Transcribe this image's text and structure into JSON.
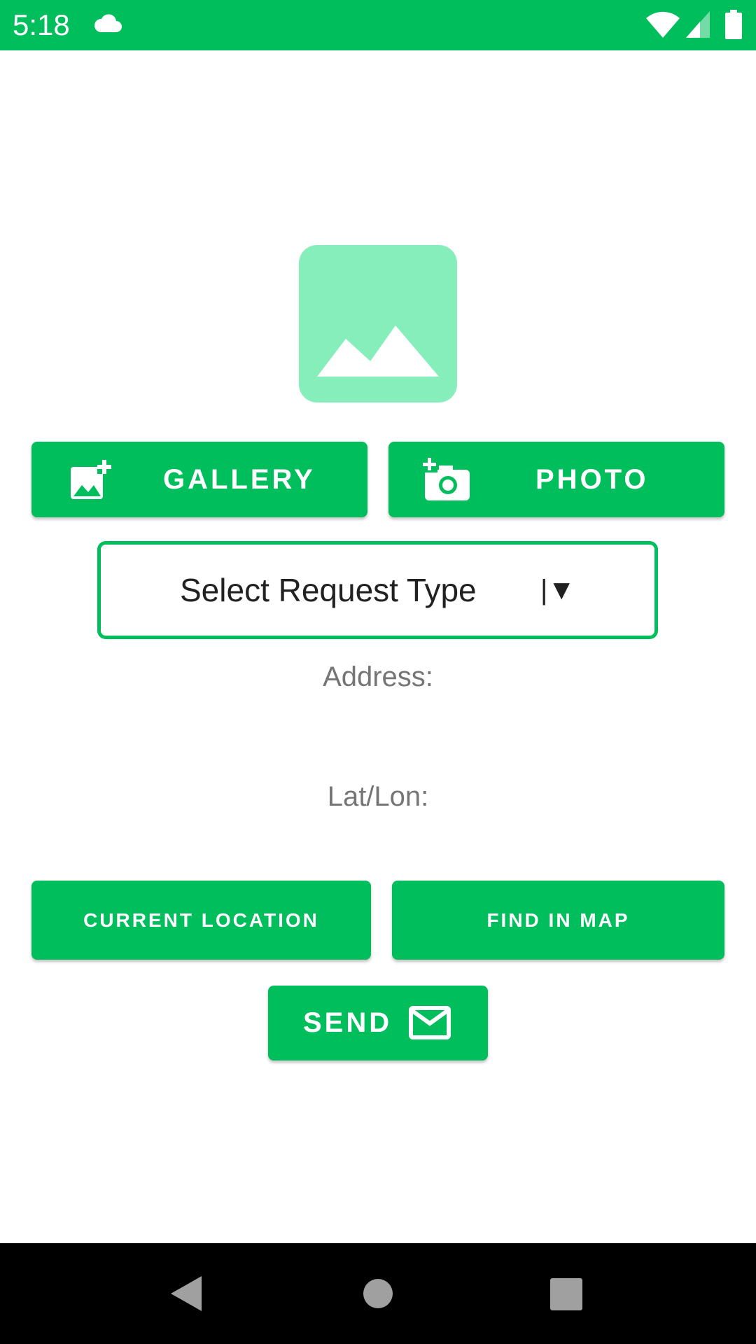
{
  "status_bar": {
    "time": "5:18",
    "background_color": "#00BE5C",
    "icons": [
      "cloud-icon",
      "wifi-icon",
      "cell-signal-icon",
      "battery-icon"
    ]
  },
  "image_placeholder": {
    "icon": "image-placeholder-icon",
    "background_color": "#86EEBB"
  },
  "buttons": {
    "gallery": {
      "label": "GALLERY",
      "icon": "add-photo-icon"
    },
    "photo": {
      "label": "PHOTO",
      "icon": "add-camera-icon"
    },
    "current_location": {
      "label": "CURRENT LOCATION"
    },
    "find_in_map": {
      "label": "FIND IN MAP"
    },
    "send": {
      "label": "SEND",
      "icon": "mail-icon"
    }
  },
  "request_type": {
    "selected_value": "Select Request Type",
    "arrow": "|▼"
  },
  "address": {
    "label": "Address:"
  },
  "latlon": {
    "label": "Lat/Lon:"
  },
  "theme": {
    "accent": "#00BE5C",
    "light_accent": "#86EEBB",
    "label_gray": "#757575"
  },
  "nav_bar": {
    "icons": [
      "back-icon",
      "home-icon",
      "recents-icon"
    ]
  }
}
